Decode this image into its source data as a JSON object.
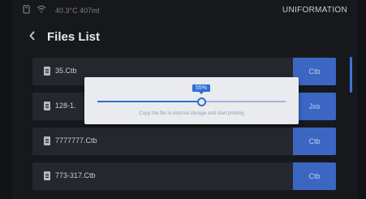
{
  "status_bar": {
    "status_text": "40.3°C 407ml",
    "brand": "UNIFORMATION",
    "icons": [
      "printer-icon",
      "wifi-icon"
    ]
  },
  "header": {
    "back_icon": "chevron-left-icon",
    "title": "Files List"
  },
  "files": [
    {
      "name": "35.Ctb",
      "type": "Ctb"
    },
    {
      "name": "128-1.",
      "type": "Jxs"
    },
    {
      "name": "7777777.Ctb",
      "type": "Ctb"
    },
    {
      "name": "773-317.Ctb",
      "type": "Ctb"
    }
  ],
  "dialog": {
    "progress_label": "55%",
    "progress": 0.55,
    "message": "Copy the file to internal storage and start printing"
  },
  "colors": {
    "accent": "#3b66c2",
    "progress": "#2e6fd3",
    "background": "#17181c",
    "row": "#24272e"
  }
}
